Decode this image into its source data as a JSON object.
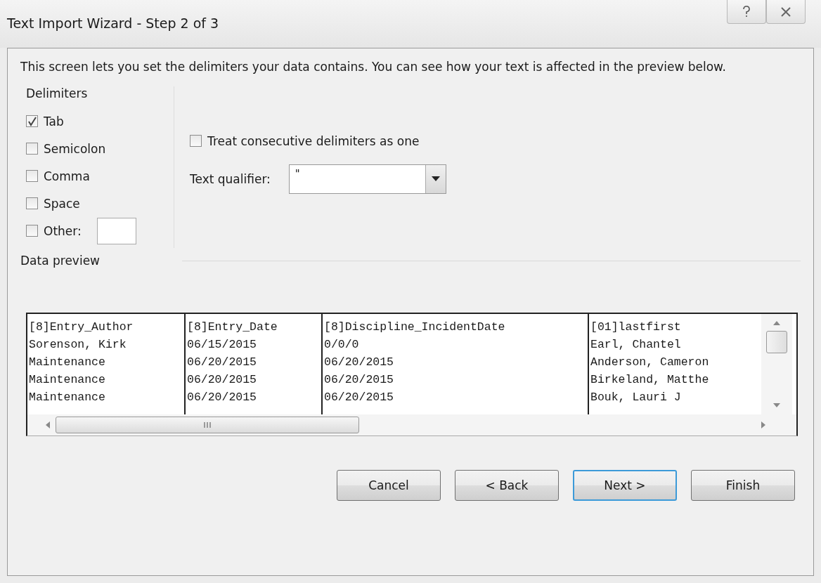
{
  "window": {
    "title": "Text Import Wizard - Step 2 of 3"
  },
  "description": "This screen lets you set the delimiters your data contains.  You can see how your text is affected in the preview below.",
  "delimiters": {
    "label": "Delimiters",
    "options": [
      {
        "label": "Tab",
        "checked": true,
        "kind": "plain"
      },
      {
        "label": "Semicolon",
        "checked": false,
        "kind": "plain"
      },
      {
        "label": "Comma",
        "checked": false,
        "kind": "plain"
      },
      {
        "label": "Space",
        "checked": false,
        "kind": "plain"
      },
      {
        "label": "Other:",
        "checked": false,
        "kind": "with_field"
      }
    ]
  },
  "treat_consecutive": {
    "label": "Treat consecutive delimiters as one",
    "checked": false
  },
  "text_qualifier": {
    "label": "Text qualifier:",
    "value": "\""
  },
  "data_preview": {
    "label": "Data preview",
    "rows": [
      [
        "[8]Entry_Author",
        "[8]Entry_Date",
        "[8]Discipline_IncidentDate",
        "[01]lastfirst"
      ],
      [
        "Sorenson, Kirk",
        "06/15/2015",
        "0/0/0",
        "Earl, Chantel"
      ],
      [
        "Maintenance",
        "06/20/2015",
        "06/20/2015",
        "Anderson, Cameron"
      ],
      [
        "Maintenance",
        "06/20/2015",
        "06/20/2015",
        "Birkeland, Matthe"
      ],
      [
        "Maintenance",
        "06/20/2015",
        "06/20/2015",
        "Bouk, Lauri J"
      ]
    ]
  },
  "buttons": [
    {
      "label": "Cancel",
      "default": false
    },
    {
      "label": "< Back",
      "default": false
    },
    {
      "label": "Next >",
      "default": true
    },
    {
      "label": "Finish",
      "default": false
    }
  ]
}
